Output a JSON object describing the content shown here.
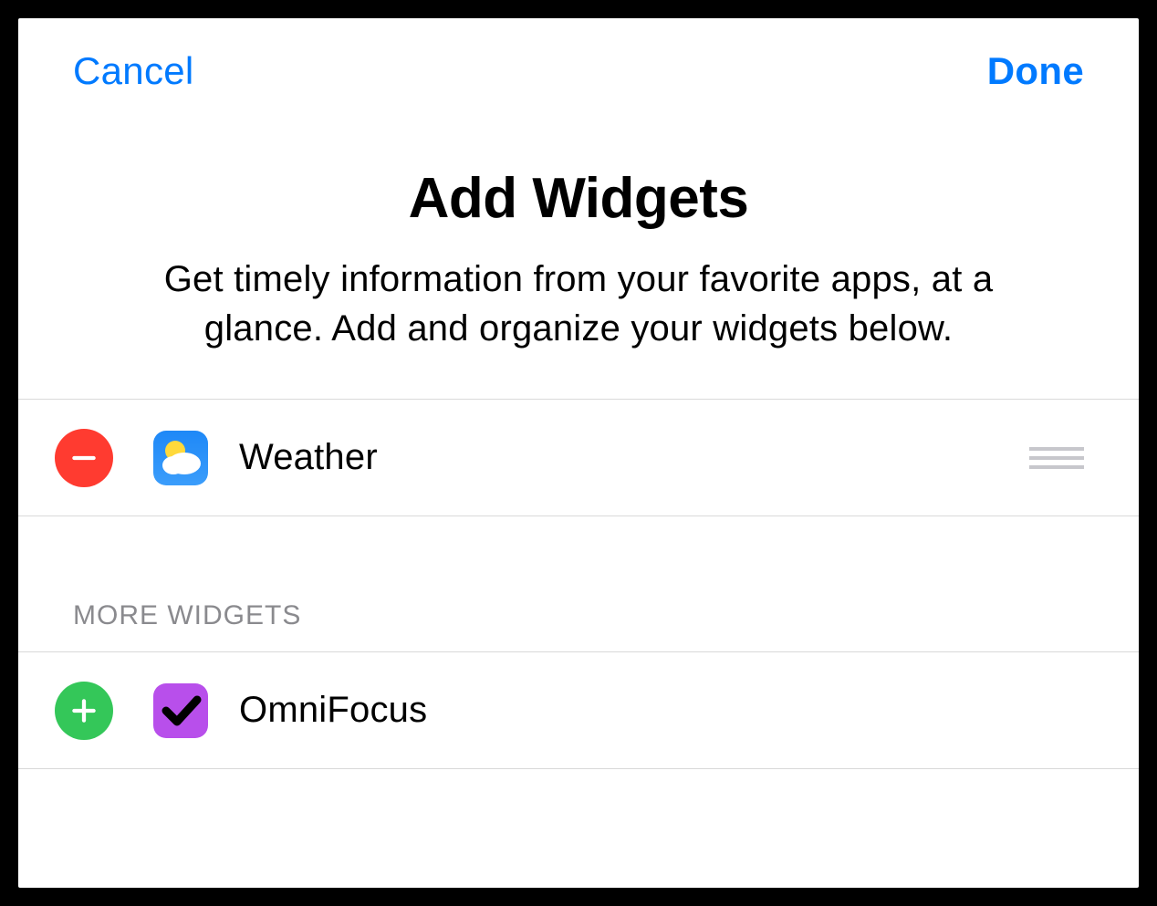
{
  "header": {
    "cancel_label": "Cancel",
    "done_label": "Done"
  },
  "title_section": {
    "title": "Add Widgets",
    "subtitle": "Get timely information from your favorite apps, at a glance. Add and organize your widgets below."
  },
  "active_widgets": [
    {
      "name": "Weather",
      "icon": "weather-icon"
    }
  ],
  "sections": {
    "more_widgets_header": "MORE WIDGETS"
  },
  "available_widgets": [
    {
      "name": "OmniFocus",
      "icon": "omnifocus-icon"
    }
  ],
  "colors": {
    "link": "#007AFF",
    "remove": "#FF3B30",
    "add": "#34C759",
    "weather_bg": "#1E88F7",
    "omnifocus_bg": "#B84FEB"
  }
}
